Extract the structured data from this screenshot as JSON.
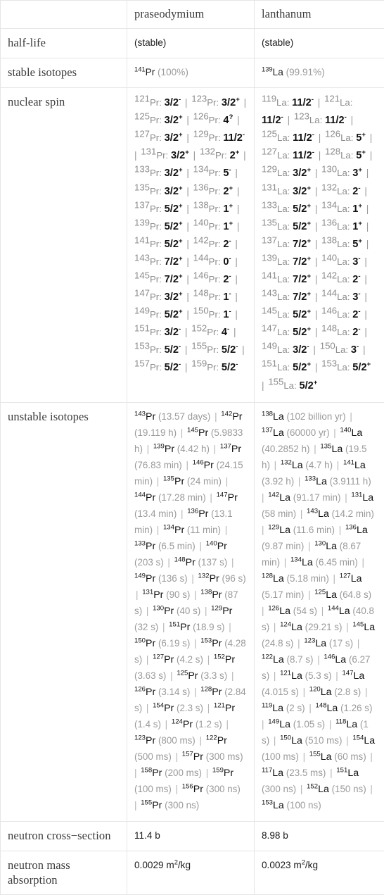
{
  "table": {
    "columns": [
      "",
      "praseodymium",
      "lanthanum"
    ],
    "rows": [
      {
        "label": "half-life",
        "pr": "(stable)",
        "la": "(stable)"
      },
      {
        "label": "stable isotopes",
        "pr": "",
        "la": ""
      },
      {
        "label": "nuclear spin",
        "pr": "",
        "la": ""
      },
      {
        "label": "unstable isotopes",
        "pr": "",
        "la": ""
      },
      {
        "label": "neutron cross-section",
        "pr": "11.4 b",
        "la": "8.98 b"
      },
      {
        "label": "neutron mass absorption",
        "pr": "0.0029 m2/kg",
        "la": "0.0023 m2/kg"
      }
    ]
  },
  "half_life": {
    "pr": "(stable)",
    "la": "(stable)"
  },
  "stable_isotopes": {
    "pr": [
      {
        "mass": "141",
        "el": "Pr",
        "abundance": "(100%)"
      }
    ],
    "la": [
      {
        "mass": "139",
        "el": "La",
        "abundance": "(99.91%)"
      }
    ]
  },
  "nuclear_spin": {
    "pr": [
      {
        "mass": "121",
        "el": "Pr",
        "spin": "3/2",
        "sign": "-"
      },
      {
        "mass": "123",
        "el": "Pr",
        "spin": "3/2",
        "sign": "+"
      },
      {
        "mass": "125",
        "el": "Pr",
        "spin": "3/2",
        "sign": "+"
      },
      {
        "mass": "126",
        "el": "Pr",
        "spin": "4",
        "sign": "?"
      },
      {
        "mass": "127",
        "el": "Pr",
        "spin": "3/2",
        "sign": "+"
      },
      {
        "mass": "129",
        "el": "Pr",
        "spin": "11/2",
        "sign": "-"
      },
      {
        "mass": "131",
        "el": "Pr",
        "spin": "3/2",
        "sign": "+"
      },
      {
        "mass": "132",
        "el": "Pr",
        "spin": "2",
        "sign": "+"
      },
      {
        "mass": "133",
        "el": "Pr",
        "spin": "3/2",
        "sign": "+"
      },
      {
        "mass": "134",
        "el": "Pr",
        "spin": "5",
        "sign": "-"
      },
      {
        "mass": "135",
        "el": "Pr",
        "spin": "3/2",
        "sign": "+"
      },
      {
        "mass": "136",
        "el": "Pr",
        "spin": "2",
        "sign": "+"
      },
      {
        "mass": "137",
        "el": "Pr",
        "spin": "5/2",
        "sign": "+"
      },
      {
        "mass": "138",
        "el": "Pr",
        "spin": "1",
        "sign": "+"
      },
      {
        "mass": "139",
        "el": "Pr",
        "spin": "5/2",
        "sign": "+"
      },
      {
        "mass": "140",
        "el": "Pr",
        "spin": "1",
        "sign": "+"
      },
      {
        "mass": "141",
        "el": "Pr",
        "spin": "5/2",
        "sign": "+"
      },
      {
        "mass": "142",
        "el": "Pr",
        "spin": "2",
        "sign": "-"
      },
      {
        "mass": "143",
        "el": "Pr",
        "spin": "7/2",
        "sign": "+"
      },
      {
        "mass": "144",
        "el": "Pr",
        "spin": "0",
        "sign": "-"
      },
      {
        "mass": "145",
        "el": "Pr",
        "spin": "7/2",
        "sign": "+"
      },
      {
        "mass": "146",
        "el": "Pr",
        "spin": "2",
        "sign": "-"
      },
      {
        "mass": "147",
        "el": "Pr",
        "spin": "3/2",
        "sign": "+"
      },
      {
        "mass": "148",
        "el": "Pr",
        "spin": "1",
        "sign": "-"
      },
      {
        "mass": "149",
        "el": "Pr",
        "spin": "5/2",
        "sign": "+"
      },
      {
        "mass": "150",
        "el": "Pr",
        "spin": "1",
        "sign": "-"
      },
      {
        "mass": "151",
        "el": "Pr",
        "spin": "3/2",
        "sign": "-"
      },
      {
        "mass": "152",
        "el": "Pr",
        "spin": "4",
        "sign": "-"
      },
      {
        "mass": "153",
        "el": "Pr",
        "spin": "5/2",
        "sign": "-"
      },
      {
        "mass": "155",
        "el": "Pr",
        "spin": "5/2",
        "sign": "-"
      },
      {
        "mass": "157",
        "el": "Pr",
        "spin": "5/2",
        "sign": "-"
      },
      {
        "mass": "159",
        "el": "Pr",
        "spin": "5/2",
        "sign": "-"
      }
    ],
    "la": [
      {
        "mass": "119",
        "el": "La",
        "spin": "11/2",
        "sign": "-"
      },
      {
        "mass": "121",
        "el": "La",
        "spin": "11/2",
        "sign": "-"
      },
      {
        "mass": "123",
        "el": "La",
        "spin": "11/2",
        "sign": "-"
      },
      {
        "mass": "125",
        "el": "La",
        "spin": "11/2",
        "sign": "-"
      },
      {
        "mass": "126",
        "el": "La",
        "spin": "5",
        "sign": "+"
      },
      {
        "mass": "127",
        "el": "La",
        "spin": "11/2",
        "sign": "-"
      },
      {
        "mass": "128",
        "el": "La",
        "spin": "5",
        "sign": "+"
      },
      {
        "mass": "129",
        "el": "La",
        "spin": "3/2",
        "sign": "+"
      },
      {
        "mass": "130",
        "el": "La",
        "spin": "3",
        "sign": "+"
      },
      {
        "mass": "131",
        "el": "La",
        "spin": "3/2",
        "sign": "+"
      },
      {
        "mass": "132",
        "el": "La",
        "spin": "2",
        "sign": "-"
      },
      {
        "mass": "133",
        "el": "La",
        "spin": "5/2",
        "sign": "+"
      },
      {
        "mass": "134",
        "el": "La",
        "spin": "1",
        "sign": "+"
      },
      {
        "mass": "135",
        "el": "La",
        "spin": "5/2",
        "sign": "+"
      },
      {
        "mass": "136",
        "el": "La",
        "spin": "1",
        "sign": "+"
      },
      {
        "mass": "137",
        "el": "La",
        "spin": "7/2",
        "sign": "+"
      },
      {
        "mass": "138",
        "el": "La",
        "spin": "5",
        "sign": "+"
      },
      {
        "mass": "139",
        "el": "La",
        "spin": "7/2",
        "sign": "+"
      },
      {
        "mass": "140",
        "el": "La",
        "spin": "3",
        "sign": "-"
      },
      {
        "mass": "141",
        "el": "La",
        "spin": "7/2",
        "sign": "+"
      },
      {
        "mass": "142",
        "el": "La",
        "spin": "2",
        "sign": "-"
      },
      {
        "mass": "143",
        "el": "La",
        "spin": "7/2",
        "sign": "+"
      },
      {
        "mass": "144",
        "el": "La",
        "spin": "3",
        "sign": "-"
      },
      {
        "mass": "145",
        "el": "La",
        "spin": "5/2",
        "sign": "+"
      },
      {
        "mass": "146",
        "el": "La",
        "spin": "2",
        "sign": "-"
      },
      {
        "mass": "147",
        "el": "La",
        "spin": "5/2",
        "sign": "+"
      },
      {
        "mass": "148",
        "el": "La",
        "spin": "2",
        "sign": "-"
      },
      {
        "mass": "149",
        "el": "La",
        "spin": "3/2",
        "sign": "-"
      },
      {
        "mass": "150",
        "el": "La",
        "spin": "3",
        "sign": "-"
      },
      {
        "mass": "151",
        "el": "La",
        "spin": "5/2",
        "sign": "+"
      },
      {
        "mass": "153",
        "el": "La",
        "spin": "5/2",
        "sign": "+"
      },
      {
        "mass": "155",
        "el": "La",
        "spin": "5/2",
        "sign": "+"
      }
    ]
  },
  "unstable_isotopes": {
    "pr": [
      {
        "mass": "143",
        "el": "Pr",
        "half_life": "(13.57 days)"
      },
      {
        "mass": "142",
        "el": "Pr",
        "half_life": "(19.119 h)"
      },
      {
        "mass": "145",
        "el": "Pr",
        "half_life": "(5.9833 h)"
      },
      {
        "mass": "139",
        "el": "Pr",
        "half_life": "(4.42 h)"
      },
      {
        "mass": "137",
        "el": "Pr",
        "half_life": "(76.83 min)"
      },
      {
        "mass": "146",
        "el": "Pr",
        "half_life": "(24.15 min)"
      },
      {
        "mass": "135",
        "el": "Pr",
        "half_life": "(24 min)"
      },
      {
        "mass": "144",
        "el": "Pr",
        "half_life": "(17.28 min)"
      },
      {
        "mass": "147",
        "el": "Pr",
        "half_life": "(13.4 min)"
      },
      {
        "mass": "136",
        "el": "Pr",
        "half_life": "(13.1 min)"
      },
      {
        "mass": "134",
        "el": "Pr",
        "half_life": "(11 min)"
      },
      {
        "mass": "133",
        "el": "Pr",
        "half_life": "(6.5 min)"
      },
      {
        "mass": "140",
        "el": "Pr",
        "half_life": "(203 s)"
      },
      {
        "mass": "148",
        "el": "Pr",
        "half_life": "(137 s)"
      },
      {
        "mass": "149",
        "el": "Pr",
        "half_life": "(136 s)"
      },
      {
        "mass": "132",
        "el": "Pr",
        "half_life": "(96 s)"
      },
      {
        "mass": "131",
        "el": "Pr",
        "half_life": "(90 s)"
      },
      {
        "mass": "138",
        "el": "Pr",
        "half_life": "(87 s)"
      },
      {
        "mass": "130",
        "el": "Pr",
        "half_life": "(40 s)"
      },
      {
        "mass": "129",
        "el": "Pr",
        "half_life": "(32 s)"
      },
      {
        "mass": "151",
        "el": "Pr",
        "half_life": "(18.9 s)"
      },
      {
        "mass": "150",
        "el": "Pr",
        "half_life": "(6.19 s)"
      },
      {
        "mass": "153",
        "el": "Pr",
        "half_life": "(4.28 s)"
      },
      {
        "mass": "127",
        "el": "Pr",
        "half_life": "(4.2 s)"
      },
      {
        "mass": "152",
        "el": "Pr",
        "half_life": "(3.63 s)"
      },
      {
        "mass": "125",
        "el": "Pr",
        "half_life": "(3.3 s)"
      },
      {
        "mass": "126",
        "el": "Pr",
        "half_life": "(3.14 s)"
      },
      {
        "mass": "128",
        "el": "Pr",
        "half_life": "(2.84 s)"
      },
      {
        "mass": "154",
        "el": "Pr",
        "half_life": "(2.3 s)"
      },
      {
        "mass": "121",
        "el": "Pr",
        "half_life": "(1.4 s)"
      },
      {
        "mass": "124",
        "el": "Pr",
        "half_life": "(1.2 s)"
      },
      {
        "mass": "123",
        "el": "Pr",
        "half_life": "(800 ms)"
      },
      {
        "mass": "122",
        "el": "Pr",
        "half_life": "(500 ms)"
      },
      {
        "mass": "157",
        "el": "Pr",
        "half_life": "(300 ms)"
      },
      {
        "mass": "158",
        "el": "Pr",
        "half_life": "(200 ms)"
      },
      {
        "mass": "159",
        "el": "Pr",
        "half_life": "(100 ms)"
      },
      {
        "mass": "156",
        "el": "Pr",
        "half_life": "(300 ns)"
      },
      {
        "mass": "155",
        "el": "Pr",
        "half_life": "(300 ns)"
      }
    ],
    "la": [
      {
        "mass": "138",
        "el": "La",
        "half_life": "(102 billion yr)"
      },
      {
        "mass": "137",
        "el": "La",
        "half_life": "(60000 yr)"
      },
      {
        "mass": "140",
        "el": "La",
        "half_life": "(40.2852 h)"
      },
      {
        "mass": "135",
        "el": "La",
        "half_life": "(19.5 h)"
      },
      {
        "mass": "132",
        "el": "La",
        "half_life": "(4.7 h)"
      },
      {
        "mass": "141",
        "el": "La",
        "half_life": "(3.92 h)"
      },
      {
        "mass": "133",
        "el": "La",
        "half_life": "(3.9111 h)"
      },
      {
        "mass": "142",
        "el": "La",
        "half_life": "(91.17 min)"
      },
      {
        "mass": "131",
        "el": "La",
        "half_life": "(58 min)"
      },
      {
        "mass": "143",
        "el": "La",
        "half_life": "(14.2 min)"
      },
      {
        "mass": "129",
        "el": "La",
        "half_life": "(11.6 min)"
      },
      {
        "mass": "136",
        "el": "La",
        "half_life": "(9.87 min)"
      },
      {
        "mass": "130",
        "el": "La",
        "half_life": "(8.67 min)"
      },
      {
        "mass": "134",
        "el": "La",
        "half_life": "(6.45 min)"
      },
      {
        "mass": "128",
        "el": "La",
        "half_life": "(5.18 min)"
      },
      {
        "mass": "127",
        "el": "La",
        "half_life": "(5.17 min)"
      },
      {
        "mass": "125",
        "el": "La",
        "half_life": "(64.8 s)"
      },
      {
        "mass": "126",
        "el": "La",
        "half_life": "(54 s)"
      },
      {
        "mass": "144",
        "el": "La",
        "half_life": "(40.8 s)"
      },
      {
        "mass": "124",
        "el": "La",
        "half_life": "(29.21 s)"
      },
      {
        "mass": "145",
        "el": "La",
        "half_life": "(24.8 s)"
      },
      {
        "mass": "123",
        "el": "La",
        "half_life": "(17 s)"
      },
      {
        "mass": "122",
        "el": "La",
        "half_life": "(8.7 s)"
      },
      {
        "mass": "146",
        "el": "La",
        "half_life": "(6.27 s)"
      },
      {
        "mass": "121",
        "el": "La",
        "half_life": "(5.3 s)"
      },
      {
        "mass": "147",
        "el": "La",
        "half_life": "(4.015 s)"
      },
      {
        "mass": "120",
        "el": "La",
        "half_life": "(2.8 s)"
      },
      {
        "mass": "119",
        "el": "La",
        "half_life": "(2 s)"
      },
      {
        "mass": "148",
        "el": "La",
        "half_life": "(1.26 s)"
      },
      {
        "mass": "149",
        "el": "La",
        "half_life": "(1.05 s)"
      },
      {
        "mass": "118",
        "el": "La",
        "half_life": "(1 s)"
      },
      {
        "mass": "150",
        "el": "La",
        "half_life": "(510 ms)"
      },
      {
        "mass": "154",
        "el": "La",
        "half_life": "(100 ms)"
      },
      {
        "mass": "155",
        "el": "La",
        "half_life": "(60 ms)"
      },
      {
        "mass": "117",
        "el": "La",
        "half_life": "(23.5 ms)"
      },
      {
        "mass": "151",
        "el": "La",
        "half_life": "(300 ns)"
      },
      {
        "mass": "152",
        "el": "La",
        "half_life": "(150 ns)"
      },
      {
        "mass": "153",
        "el": "La",
        "half_life": "(100 ns)"
      }
    ]
  },
  "neutron_cross_section": {
    "label": "neutron cross-section",
    "pr": "11.4 b",
    "la": "8.98 b"
  },
  "neutron_mass_absorption": {
    "label": "neutron mass absorption",
    "pr_value": "0.0029",
    "pr_unit_base": "m",
    "pr_unit_exp": "2",
    "pr_unit_tail": "/kg",
    "la_value": "0.0023",
    "la_unit_base": "m",
    "la_unit_exp": "2",
    "la_unit_tail": "/kg"
  },
  "labels": {
    "half_life": "half-life",
    "stable_isotopes": "stable isotopes",
    "nuclear_spin": "nuclear spin",
    "unstable_isotopes": "unstable isotopes",
    "neutron_cross_section": "neutron cross−section",
    "neutron_mass_absorption": "neutron mass absorption"
  },
  "colors": {
    "border": "#e6e6e6",
    "label_text": "#3c3c3c",
    "value_text": "#1a1a1a",
    "muted_text": "#9a9a9a"
  }
}
